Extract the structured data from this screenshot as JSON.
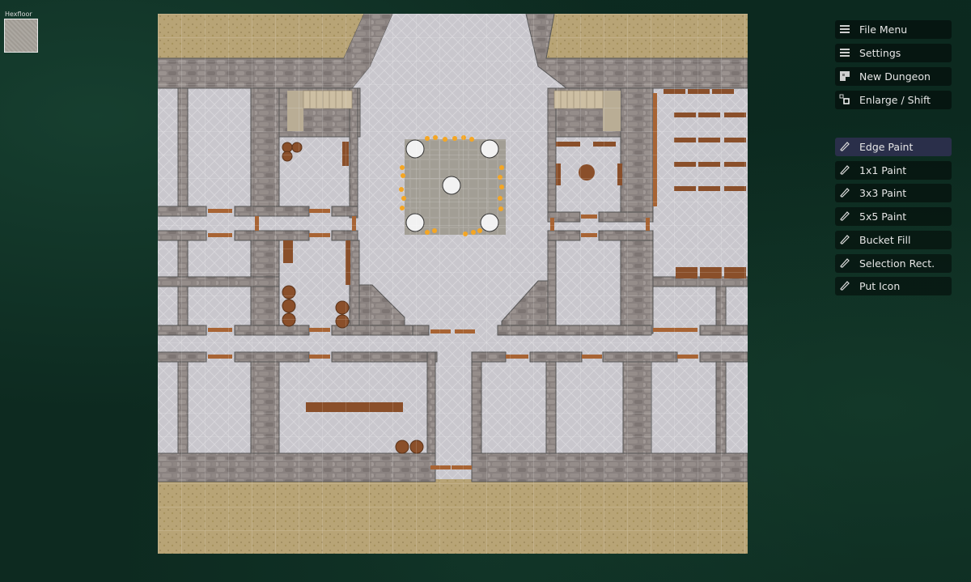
{
  "tile_preview": {
    "label": "Hexfloor",
    "color": "#a8a39c"
  },
  "menu": {
    "top_items": [
      {
        "label": "File Menu",
        "icon": "hamburger-icon"
      },
      {
        "label": "Settings",
        "icon": "hamburger-icon"
      },
      {
        "label": "New Dungeon",
        "icon": "dungeon-grid-icon"
      },
      {
        "label": "Enlarge / Shift",
        "icon": "enlarge-shift-icon"
      }
    ],
    "tool_items": [
      {
        "label": "Edge Paint",
        "icon": "pencil-icon",
        "active": true
      },
      {
        "label": "1x1 Paint",
        "icon": "pencil-icon"
      },
      {
        "label": "3x3 Paint",
        "icon": "pencil-icon"
      },
      {
        "label": "5x5 Paint",
        "icon": "pencil-icon"
      },
      {
        "label": "Bucket Fill",
        "icon": "pencil-icon"
      },
      {
        "label": "Selection Rect.",
        "icon": "pencil-icon"
      },
      {
        "label": "Put Icon",
        "icon": "pencil-icon"
      }
    ]
  },
  "map": {
    "colors": {
      "sand": "#b8a476",
      "floor": "#c8c6cc",
      "stone": "#857d7b",
      "stone_dark": "#5e5756",
      "wood": "#8a4f2a",
      "ritual": "#a9a59c",
      "fire": "#f5a623"
    }
  }
}
